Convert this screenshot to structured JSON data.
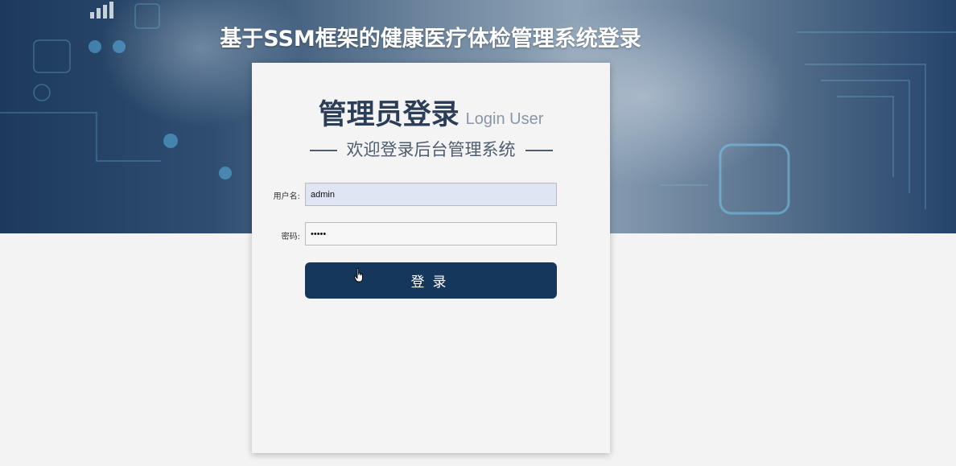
{
  "page": {
    "title": "基于SSM框架的健康医疗体检管理系统登录"
  },
  "login_panel": {
    "heading": "管理员登录",
    "heading_en": "Login User",
    "welcome": "欢迎登录后台管理系统",
    "username_label": "用户名:",
    "username_value": "admin",
    "password_label": "密码:",
    "password_value": "•••••",
    "submit_label": "登录"
  },
  "colors": {
    "button": "#15375b",
    "heading": "#2c3e57",
    "username_field_bg": "#dfe5f3"
  },
  "icons": {
    "cursor": "hand-pointer-icon"
  }
}
